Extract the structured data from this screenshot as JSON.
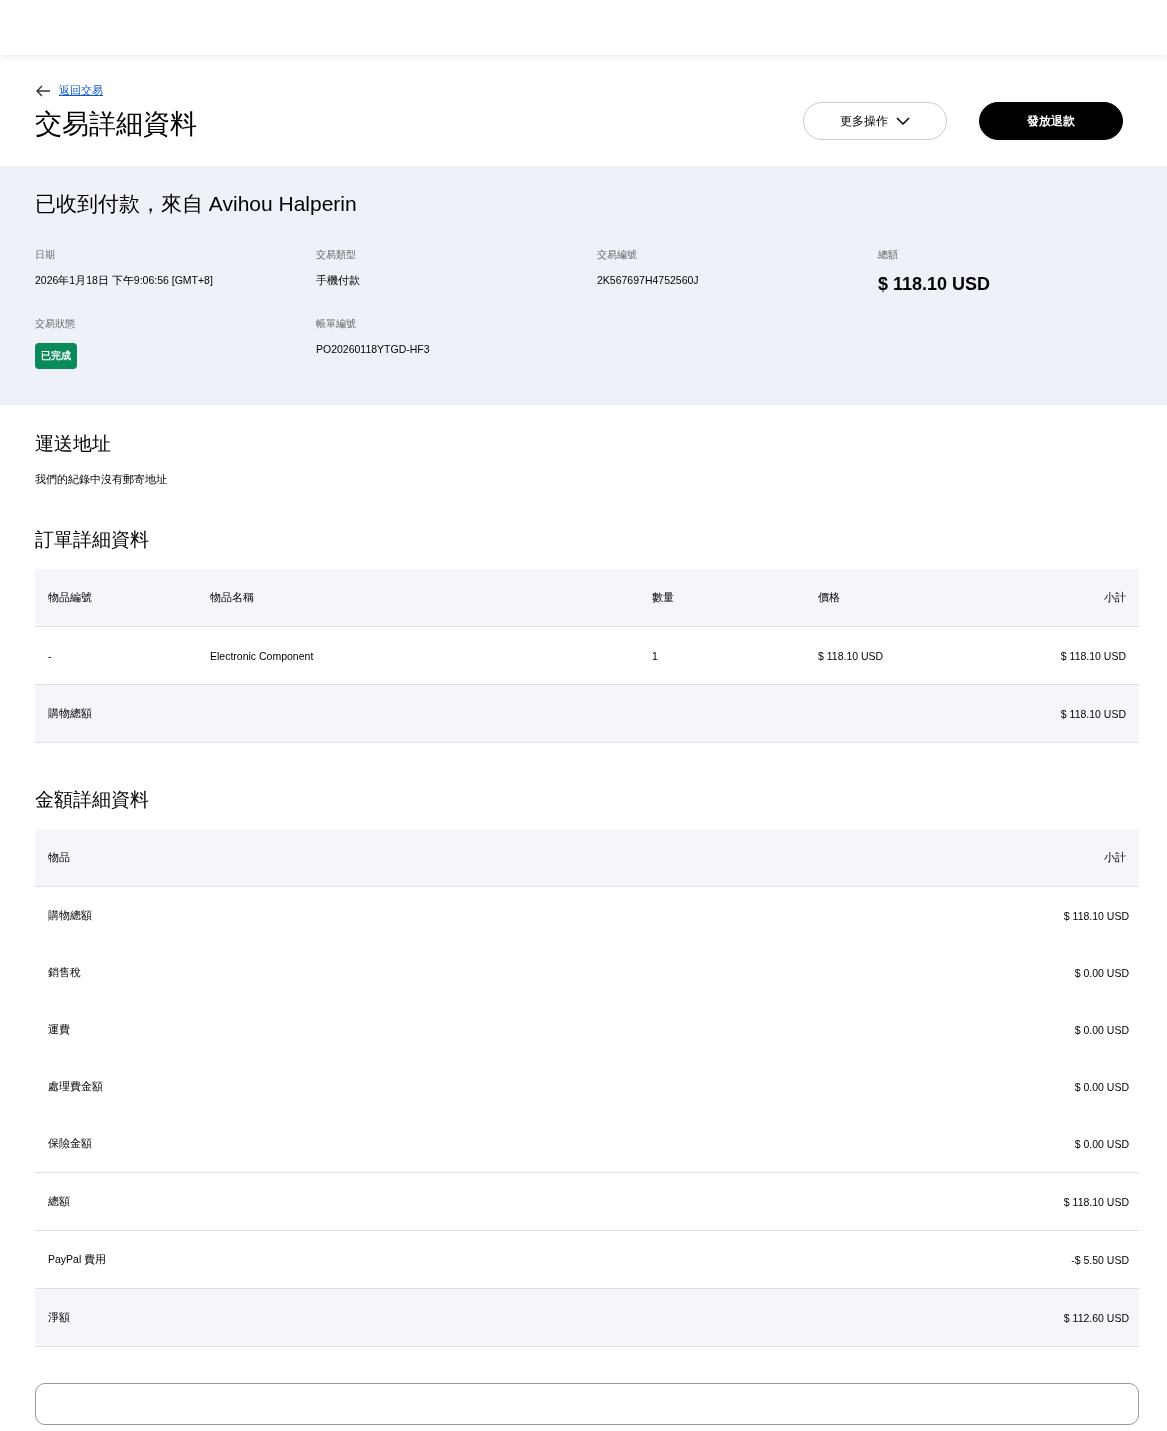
{
  "back_link": "返回交易",
  "title": "交易詳細資料",
  "actions": [
    {
      "kind": "outline",
      "label": "更多操作",
      "caret": true
    },
    {
      "kind": "solid",
      "label": "發放退款",
      "caret": false
    }
  ],
  "summary": {
    "headline": "已收到付款，來自 Avihou Halperin",
    "fields": [
      {
        "label": "日期",
        "value": "2026年1月18日 下午9:06:56 [GMT+8]",
        "kind": "text"
      },
      {
        "label": "交易類型",
        "value": "手機付款",
        "kind": "text"
      },
      {
        "label": "交易編號",
        "value": "2K567697H4752560J",
        "kind": "text"
      },
      {
        "label": "總額",
        "value": "$ 118.10 USD",
        "kind": "amount"
      },
      {
        "label": "交易狀態",
        "value": "已完成",
        "kind": "badge",
        "color": "#0b8a5a"
      },
      {
        "label": "帳單編號",
        "value": "PO20260118YTGD-HF3",
        "kind": "text"
      }
    ]
  },
  "shipping": {
    "title": "運送地址",
    "text": "我們的紀錄中沒有郵寄地址"
  },
  "order": {
    "title": "訂單詳細資料",
    "columns": [
      "物品編號",
      "物品名稱",
      "數量",
      "價格",
      "小計"
    ],
    "rows": [
      [
        "-",
        "Electronic Component",
        "1",
        "$ 118.10 USD",
        "$ 118.10 USD"
      ]
    ],
    "total": {
      "label": "購物總額",
      "value": "$ 118.10 USD"
    }
  },
  "amounts": {
    "title": "金額詳細資料",
    "columns": [
      "物品",
      "小計"
    ],
    "rows": [
      {
        "label": "購物總額",
        "value": "$ 118.10 USD",
        "kind": "plain"
      },
      {
        "label": "銷售稅",
        "value": "$ 0.00 USD",
        "kind": "plain"
      },
      {
        "label": "運費",
        "value": "$ 0.00 USD",
        "kind": "plain"
      },
      {
        "label": "處理費金額",
        "value": "$ 0.00 USD",
        "kind": "plain"
      },
      {
        "label": "保險金額",
        "value": "$ 0.00 USD",
        "kind": "plain"
      },
      {
        "label": "總額",
        "value": "$ 118.10 USD",
        "kind": "divided"
      },
      {
        "label": "PayPal 費用",
        "value": "-$ 5.50 USD",
        "kind": "divided"
      },
      {
        "label": "淨額",
        "value": "$ 112.60 USD",
        "kind": "shaded"
      }
    ]
  }
}
